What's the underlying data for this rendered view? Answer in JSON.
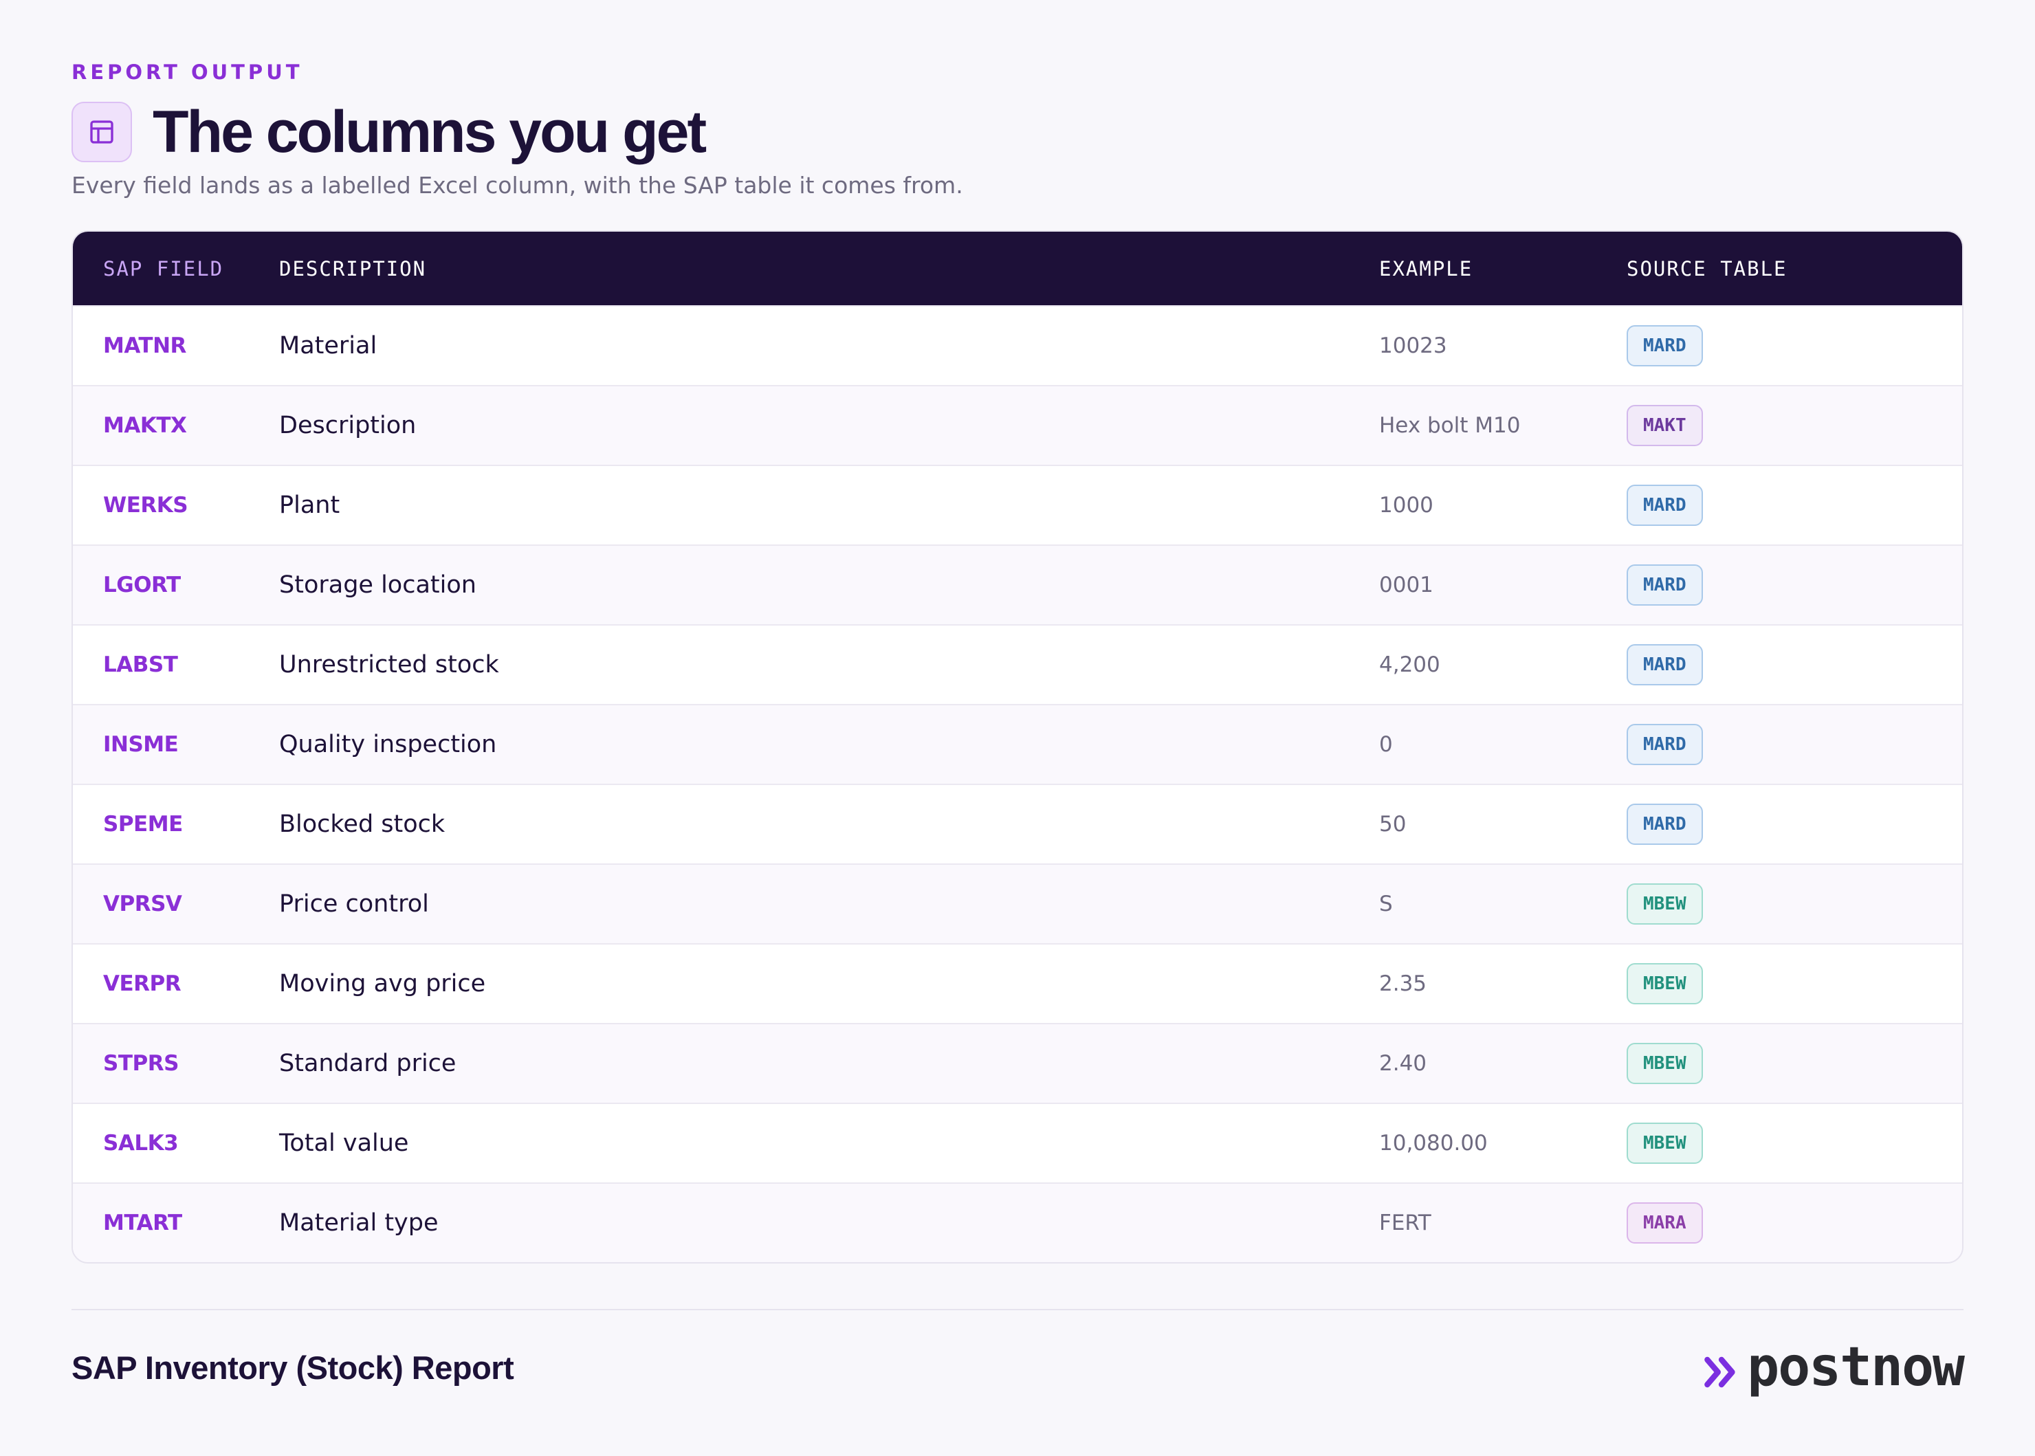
{
  "header": {
    "eyebrow": "REPORT OUTPUT",
    "title": "The columns you get",
    "subtitle": "Every field lands as a labelled Excel column, with the SAP table it comes from.",
    "icon": "table-icon"
  },
  "table": {
    "columns": [
      "SAP FIELD",
      "DESCRIPTION",
      "EXAMPLE",
      "SOURCE TABLE"
    ],
    "rows": [
      {
        "field": "MATNR",
        "description": "Material",
        "example": "10023",
        "source": "MARD"
      },
      {
        "field": "MAKTX",
        "description": "Description",
        "example": "Hex bolt M10",
        "source": "MAKT"
      },
      {
        "field": "WERKS",
        "description": "Plant",
        "example": "1000",
        "source": "MARD"
      },
      {
        "field": "LGORT",
        "description": "Storage location",
        "example": "0001",
        "source": "MARD"
      },
      {
        "field": "LABST",
        "description": "Unrestricted stock",
        "example": "4,200",
        "source": "MARD"
      },
      {
        "field": "INSME",
        "description": "Quality inspection",
        "example": "0",
        "source": "MARD"
      },
      {
        "field": "SPEME",
        "description": "Blocked stock",
        "example": "50",
        "source": "MARD"
      },
      {
        "field": "VPRSV",
        "description": "Price control",
        "example": "S",
        "source": "MBEW"
      },
      {
        "field": "VERPR",
        "description": "Moving avg price",
        "example": "2.35",
        "source": "MBEW"
      },
      {
        "field": "STPRS",
        "description": "Standard price",
        "example": "2.40",
        "source": "MBEW"
      },
      {
        "field": "SALK3",
        "description": "Total value",
        "example": "10,080.00",
        "source": "MBEW"
      },
      {
        "field": "MTART",
        "description": "Material type",
        "example": "FERT",
        "source": "MARA"
      }
    ]
  },
  "footer": {
    "title": "SAP Inventory (Stock) Report",
    "logo_text": "postnow",
    "logo_icon": "double-chevron-right-icon"
  },
  "colors": {
    "accent": "#8a2fd6",
    "header_bg": "#1d1038",
    "mard": "#2f6aa8",
    "makt": "#6c3a9d",
    "mbew": "#21917d",
    "mara": "#8a3ea8"
  }
}
